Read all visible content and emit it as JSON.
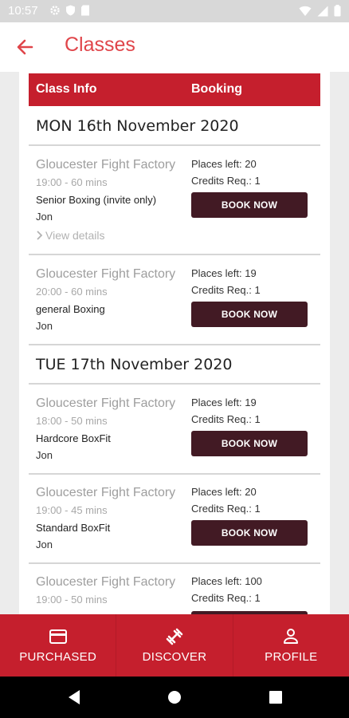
{
  "status_bar": {
    "time": "10:57"
  },
  "app_bar": {
    "title": "Classes"
  },
  "table_header": {
    "class_info": "Class Info",
    "booking": "Booking"
  },
  "days": [
    {
      "label": "MON 16th November 2020",
      "classes": [
        {
          "venue": "Gloucester Fight Factory",
          "time": "19:00 - 60 mins",
          "name": "Senior Boxing (invite only)",
          "instructor": "Jon",
          "places_label": "Places left:",
          "places": "20",
          "credits_label": "Credits Req.:",
          "credits": "1",
          "button": "BOOK NOW",
          "details": "View details"
        },
        {
          "venue": "Gloucester Fight Factory",
          "time": "20:00 - 60 mins",
          "name": "general Boxing",
          "instructor": "Jon",
          "places_label": "Places left:",
          "places": "19",
          "credits_label": "Credits Req.:",
          "credits": "1",
          "button": "BOOK NOW"
        }
      ]
    },
    {
      "label": "TUE 17th November 2020",
      "classes": [
        {
          "venue": "Gloucester Fight Factory",
          "time": "18:00 - 50 mins",
          "name": "Hardcore BoxFit",
          "instructor": "Jon",
          "places_label": "Places left:",
          "places": "19",
          "credits_label": "Credits Req.:",
          "credits": "1",
          "button": "BOOK NOW"
        },
        {
          "venue": "Gloucester Fight Factory",
          "time": "19:00 - 45 mins",
          "name": "Standard BoxFit",
          "instructor": "Jon",
          "places_label": "Places left:",
          "places": "20",
          "credits_label": "Credits Req.:",
          "credits": "1",
          "button": "BOOK NOW"
        },
        {
          "venue": "Gloucester Fight Factory",
          "time": "19:00 - 50 mins",
          "places_label": "Places left:",
          "places": "100",
          "credits_label": "Credits Req.:",
          "credits": "1"
        }
      ]
    }
  ],
  "bottom_nav": [
    {
      "label": "PURCHASED",
      "icon": "card-icon"
    },
    {
      "label": "DISCOVER",
      "icon": "dumbbell-icon"
    },
    {
      "label": "PROFILE",
      "icon": "person-icon"
    }
  ],
  "colors": {
    "brand_red": "#c51f2d",
    "title_red": "#e0454a",
    "button_dark": "#421a24"
  }
}
